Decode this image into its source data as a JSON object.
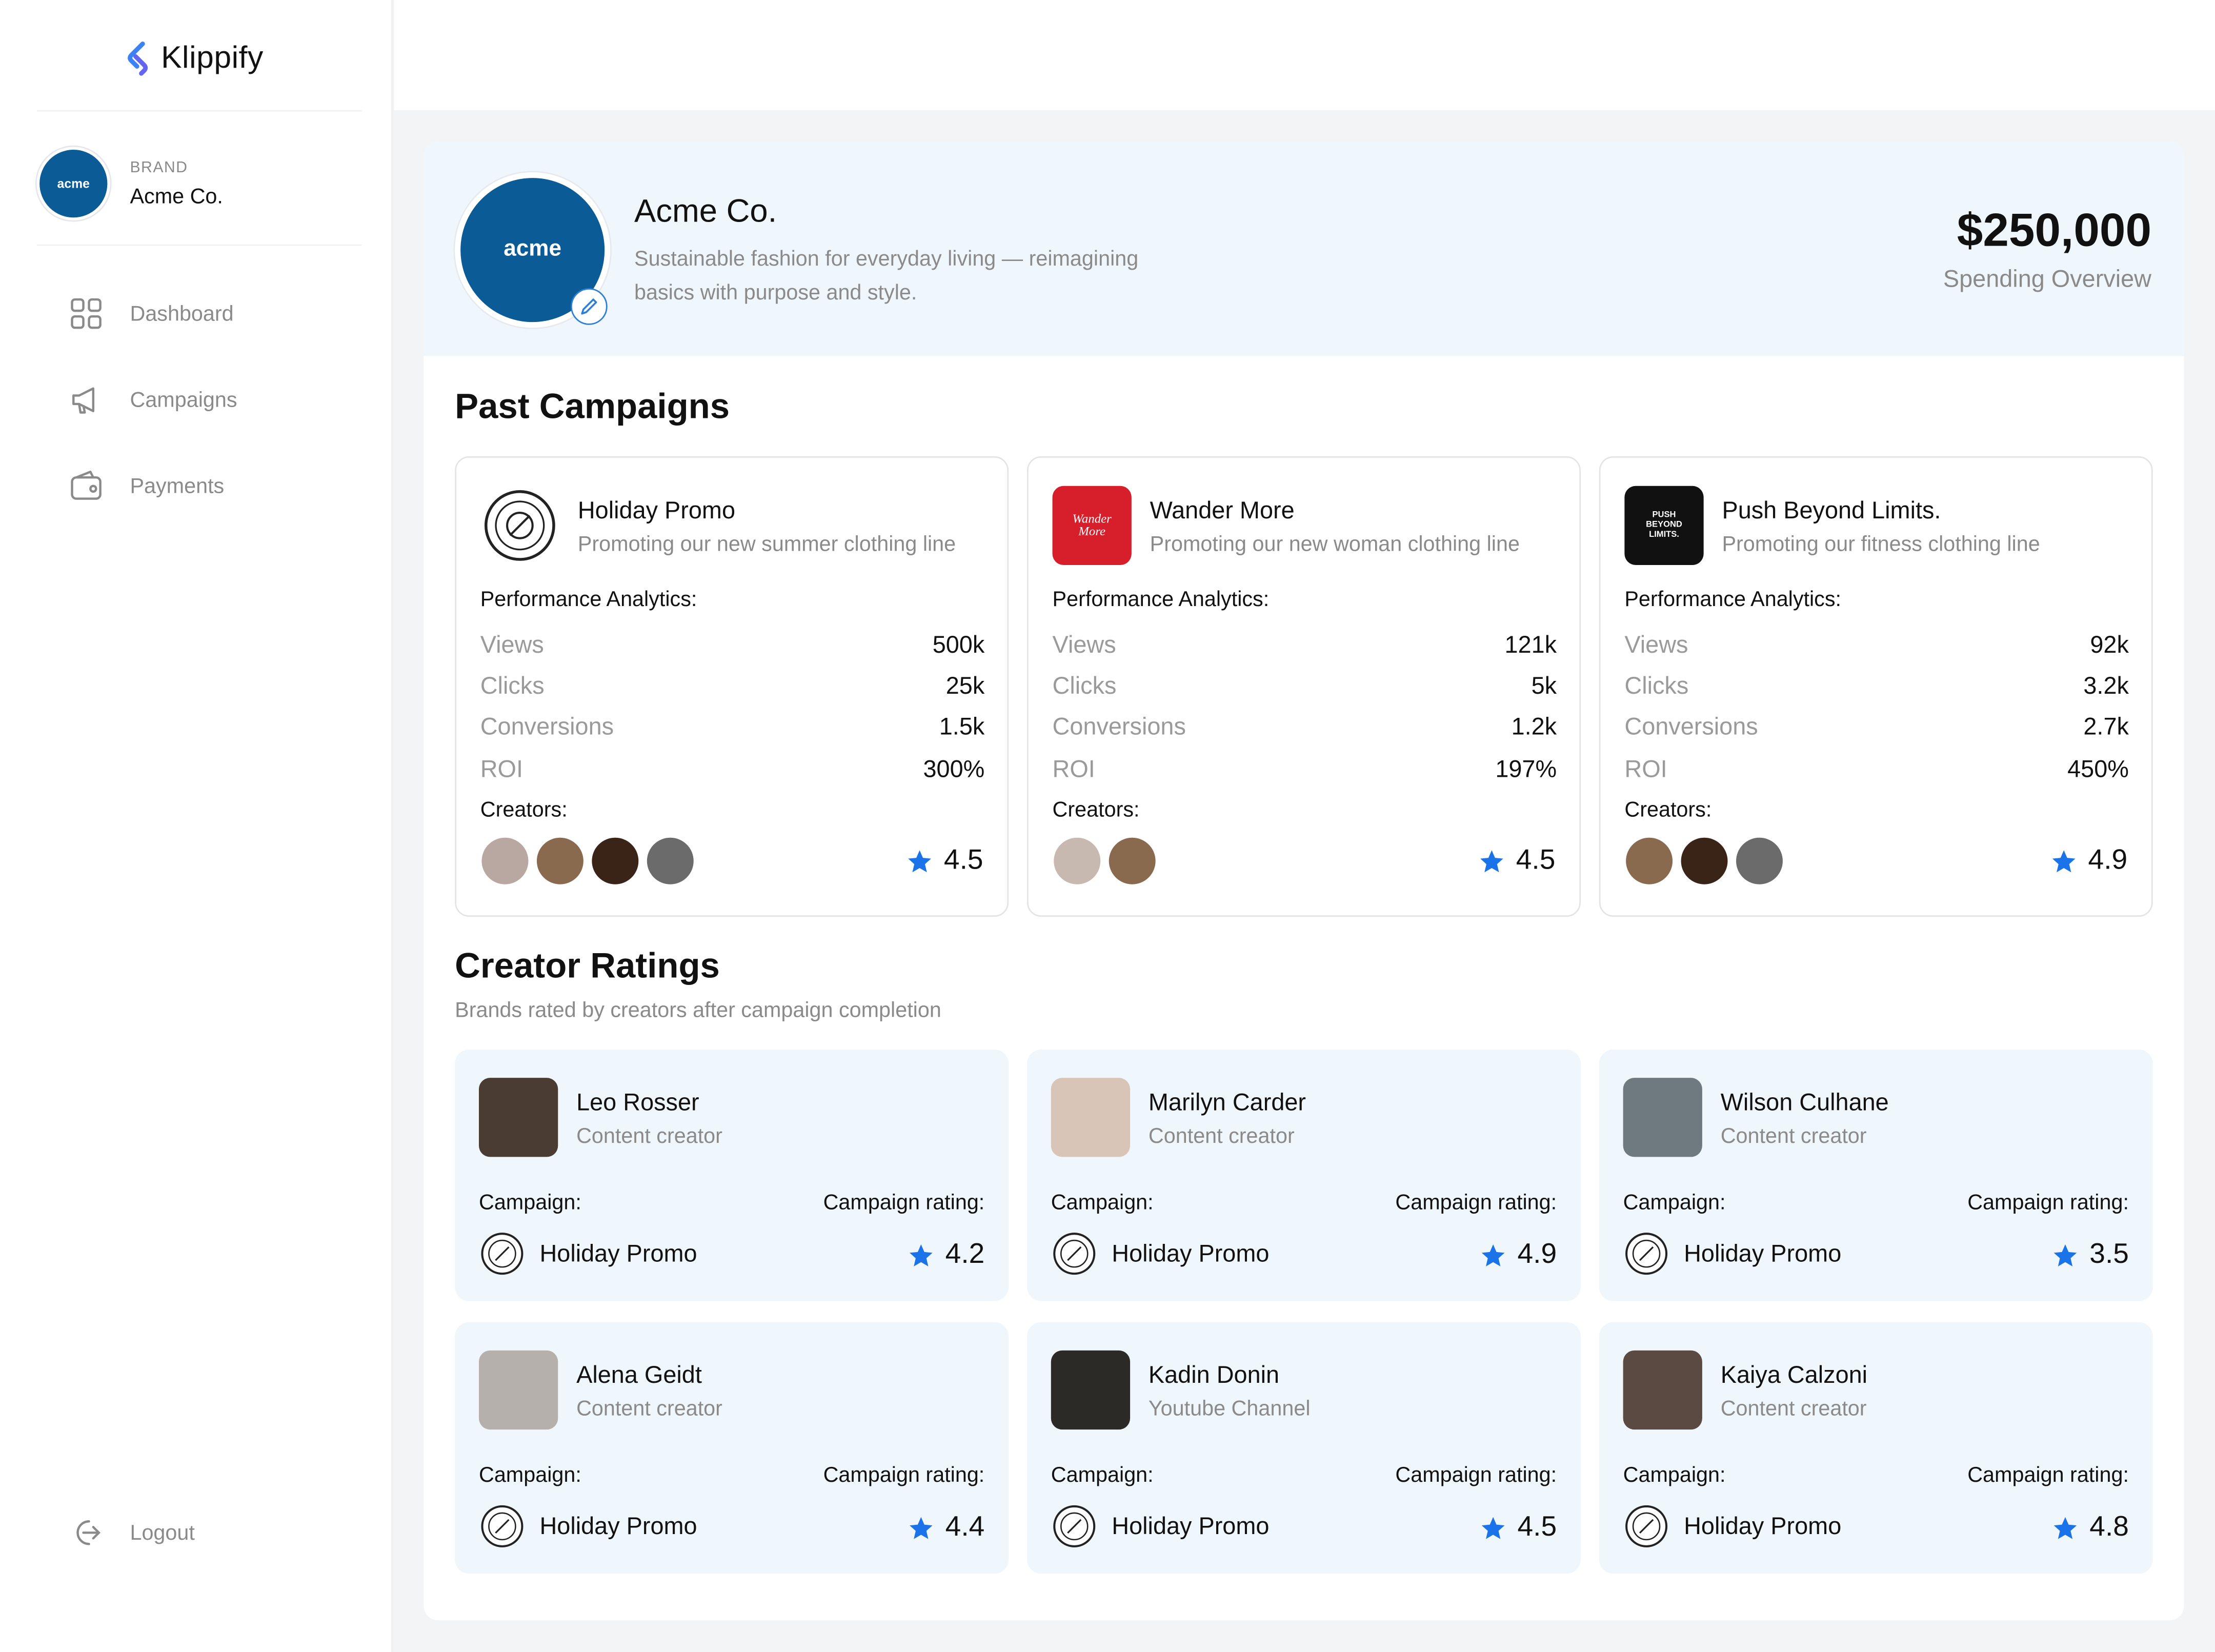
{
  "app": {
    "name": "Klippify"
  },
  "sidebar": {
    "brand_caption": "BRAND",
    "brand_name": "Acme Co.",
    "brand_logo_text": "acme",
    "nav": [
      {
        "label": "Dashboard",
        "icon": "grid-icon"
      },
      {
        "label": "Campaigns",
        "icon": "megaphone-icon"
      },
      {
        "label": "Payments",
        "icon": "wallet-icon"
      }
    ],
    "logout_label": "Logout"
  },
  "header": {
    "logo_text": "acme",
    "title": "Acme Co.",
    "description": "Sustainable fashion for everyday living — reimagining basics with purpose and style.",
    "amount": "$250,000",
    "amount_label": "Spending Overview"
  },
  "past_campaigns": {
    "title": "Past Campaigns",
    "performance_label": "Performance Analytics:",
    "creators_label": "Creators:",
    "metric_labels": [
      "Views",
      "Clicks",
      "Conversions",
      "ROI"
    ],
    "cards": [
      {
        "name": "Holiday Promo",
        "description": "Promoting our new summer clothing line",
        "logo": "perfume-free-stamp",
        "metrics": [
          "500k",
          "25k",
          "1.5k",
          "300%"
        ],
        "rating": "4.5",
        "creator_colors": [
          "#b9a7a1",
          "#8a6a4f",
          "#3a2418",
          "#6b6b6b"
        ]
      },
      {
        "name": "Wander More",
        "description": "Promoting our new woman clothing line",
        "logo": "wander-more",
        "logo_text": "Wander More",
        "metrics": [
          "121k",
          "5k",
          "1.2k",
          "197%"
        ],
        "rating": "4.5",
        "creator_colors": [
          "#c7b8b0",
          "#8a6a4f"
        ]
      },
      {
        "name": "Push Beyond Limits.",
        "description": "Promoting our fitness clothing line",
        "logo": "limits",
        "logo_text": "PUSH BEYOND LIMITS.",
        "metrics": [
          "92k",
          "3.2k",
          "2.7k",
          "450%"
        ],
        "rating": "4.9",
        "creator_colors": [
          "#8a6a4f",
          "#3a2418",
          "#6b6b6b"
        ]
      }
    ]
  },
  "creator_ratings": {
    "title": "Creator Ratings",
    "subtitle": "Brands rated by creators after campaign completion",
    "campaign_label": "Campaign:",
    "rating_label": "Campaign rating:",
    "cards": [
      {
        "name": "Leo Rosser",
        "role": "Content creator",
        "campaign": "Holiday Promo",
        "rating": "4.2",
        "photo_color": "#4a3b33"
      },
      {
        "name": "Marilyn Carder",
        "role": "Content creator",
        "campaign": "Holiday Promo",
        "rating": "4.9",
        "photo_color": "#d8c5b8"
      },
      {
        "name": "Wilson Culhane",
        "role": "Content creator",
        "campaign": "Holiday Promo",
        "rating": "3.5",
        "photo_color": "#6f7a80"
      },
      {
        "name": "Alena Geidt",
        "role": "Content creator",
        "campaign": "Holiday Promo",
        "rating": "4.4",
        "photo_color": "#b5b0ab"
      },
      {
        "name": "Kadin Donin",
        "role": "Youtube Channel",
        "campaign": "Holiday Promo",
        "rating": "4.5",
        "photo_color": "#2c2a26"
      },
      {
        "name": "Kaiya Calzoni",
        "role": "Content creator",
        "campaign": "Holiday Promo",
        "rating": "4.8",
        "photo_color": "#5a4a42"
      }
    ]
  },
  "colors": {
    "accent": "#1a73e8",
    "brand_blue": "#0b5c96",
    "header_bg": "#eff6fc",
    "wander_red": "#d71f2b"
  }
}
